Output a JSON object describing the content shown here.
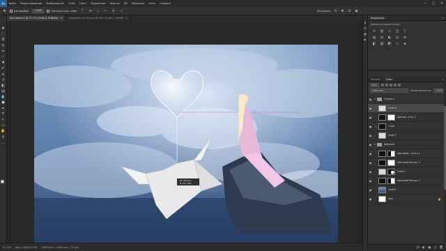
{
  "menubar": {
    "logo": "Ps",
    "items": [
      "Файл",
      "Редактирование",
      "Изображение",
      "Слои",
      "Текст",
      "Выделение",
      "Фильтр",
      "3D",
      "Просмотр",
      "Окно",
      "Справка"
    ],
    "window_controls": [
      "—",
      "□",
      "✕"
    ]
  },
  "options": {
    "autoselect_label": "Автовыбор:",
    "autoselect_value": "Слой",
    "show_transform_label": "Показать упр. элем.",
    "mode_label": "3D-режим:"
  },
  "tabs": [
    {
      "label": "Без имени-1 @ 72.7% (Слой 6, RGB/8#)",
      "active": true
    },
    {
      "label": "polyarika.com (1).png @ 99% (Слой 0, RGB/8)",
      "active": false
    }
  ],
  "status": {
    "zoom": "72,73%",
    "doc": "Док: 7,9M/152,9M",
    "size": "1386 пикс. x 888 пикс. (72 ppi)"
  },
  "canvas": {
    "measure_line1": "Ш: 78 пикс.",
    "measure_line2": "В: 157 пикс."
  },
  "adjust_panel": {
    "tabs": [
      "Коррекция"
    ],
    "hint": "Добавить корректировку"
  },
  "layers_panel": {
    "tabs": [
      "Каналы",
      "Слои"
    ],
    "filter_label": "Вид",
    "blend_mode": "Обычные",
    "opacity_label": "Непрозрачность:",
    "opacity_value": "100%",
    "lock_label": "Закрепить:",
    "fill_label": "Заливка:",
    "fill_value": "100%",
    "layers": [
      {
        "name": "Группа 1",
        "kind": "group",
        "thumb": "folder"
      },
      {
        "name": "Слой 6",
        "kind": "layer",
        "thumb": "checker",
        "selected": true
      },
      {
        "name": "Цветов...ость 1",
        "kind": "adj",
        "thumb": "black",
        "mask": "white"
      },
      {
        "name": "Слой",
        "kind": "layer",
        "thumb": "black"
      },
      {
        "name": "Слой 3",
        "kind": "layer",
        "thumb": "checker"
      },
      {
        "name": "Девушка",
        "kind": "group",
        "thumb": "folder"
      },
      {
        "name": "Цветовой...ность 1",
        "kind": "adj",
        "thumb": "black",
        "mask": "partial"
      },
      {
        "name": "Цветовой баланс 2",
        "kind": "adj",
        "thumb": "black",
        "mask": "white"
      },
      {
        "name": "Слой 2",
        "kind": "layer",
        "thumb": "checker",
        "mask": "blob"
      },
      {
        "name": "Цветовой баланс 1",
        "kind": "adj",
        "thumb": "black",
        "mask": "partial"
      },
      {
        "name": "Слой 1",
        "kind": "layer",
        "thumb": "sky"
      },
      {
        "name": "Фон",
        "kind": "bg",
        "thumb": "white"
      }
    ],
    "bottom_icons": [
      "ƒx",
      "◐",
      "▣",
      "❏",
      "🗑"
    ]
  }
}
